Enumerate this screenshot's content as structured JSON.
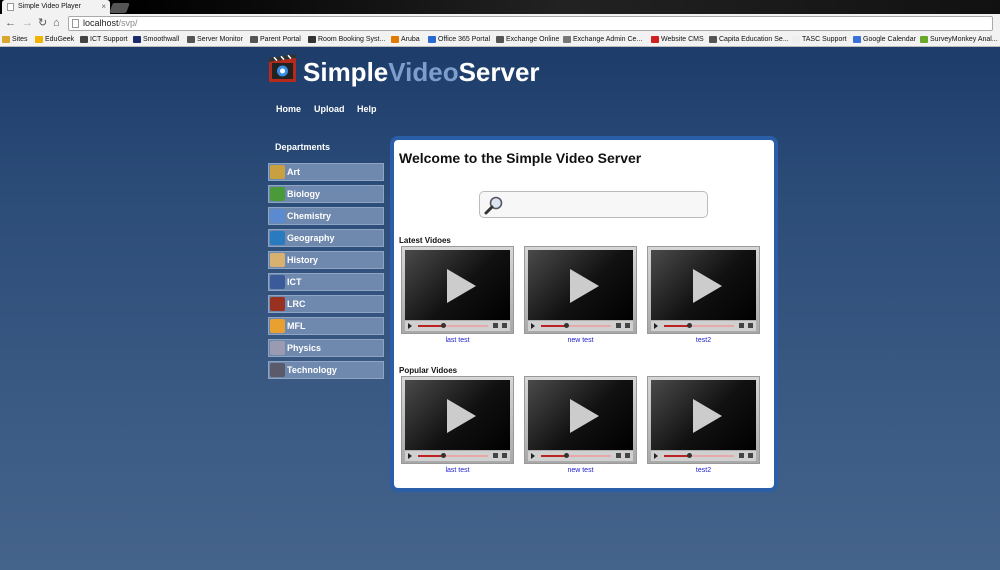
{
  "browser": {
    "tab_title": "Simple Video Player",
    "url_host": "localhost",
    "url_path": "/svp/",
    "bookmarks": [
      {
        "label": "Sites",
        "color": "#d9a62e"
      },
      {
        "label": "EduGeek",
        "color": "#f0b400"
      },
      {
        "label": "ICT Support",
        "color": "#444444"
      },
      {
        "label": "Smoothwall",
        "color": "#1a2a6a"
      },
      {
        "label": "Server Monitor",
        "color": "#555555"
      },
      {
        "label": "Parent Portal",
        "color": "#555555"
      },
      {
        "label": "Room Booking Syst...",
        "color": "#333333"
      },
      {
        "label": "Aruba",
        "color": "#e07a00"
      },
      {
        "label": "Office 365 Portal",
        "color": "#2a6ad0"
      },
      {
        "label": "Exchange Online",
        "color": "#555555"
      },
      {
        "label": "Exchange Admin Ce...",
        "color": "#777777"
      },
      {
        "label": "Website CMS",
        "color": "#d02020"
      },
      {
        "label": "Capita Education Se...",
        "color": "#555555"
      },
      {
        "label": "TASC Support",
        "color": "#eeeeee"
      },
      {
        "label": "Google Calendar",
        "color": "#3a70d8"
      },
      {
        "label": "SurveyMonkey Anal...",
        "color": "#6aa82a"
      }
    ]
  },
  "site": {
    "logo_part1": "Simple",
    "logo_part2": "Video",
    "logo_part3": "Server"
  },
  "nav": [
    "Home",
    "Upload",
    "Help"
  ],
  "departments_heading": "Departments",
  "departments": [
    {
      "label": "Art",
      "icon": "palette-icon",
      "color": "#c8a040"
    },
    {
      "label": "Biology",
      "icon": "plant-icon",
      "color": "#4a9a3a"
    },
    {
      "label": "Chemistry",
      "icon": "flask-icon",
      "color": "#5a8ad0"
    },
    {
      "label": "Geography",
      "icon": "globe-icon",
      "color": "#2a7ac0"
    },
    {
      "label": "History",
      "icon": "scroll-icon",
      "color": "#d8b070"
    },
    {
      "label": "ICT",
      "icon": "computer-icon",
      "color": "#3a5a9a"
    },
    {
      "label": "LRC",
      "icon": "books-icon",
      "color": "#9a3020"
    },
    {
      "label": "MFL",
      "icon": "speech-icon",
      "color": "#e8a030"
    },
    {
      "label": "Physics",
      "icon": "atom-icon",
      "color": "#9a9ab0"
    },
    {
      "label": "Technology",
      "icon": "tools-icon",
      "color": "#5a5a6a"
    }
  ],
  "main": {
    "welcome": "Welcome to the Simple Video Server",
    "latest_heading": "Latest Vidoes",
    "popular_heading": "Popular Vidoes",
    "latest_videos": [
      {
        "title": "last test",
        "progress": 0.35
      },
      {
        "title": "new test",
        "progress": 0.35
      },
      {
        "title": "test2",
        "progress": 0.35
      }
    ],
    "popular_videos": [
      {
        "title": "last test",
        "progress": 0.35
      },
      {
        "title": "new test",
        "progress": 0.35
      },
      {
        "title": "test2",
        "progress": 0.35
      }
    ]
  }
}
